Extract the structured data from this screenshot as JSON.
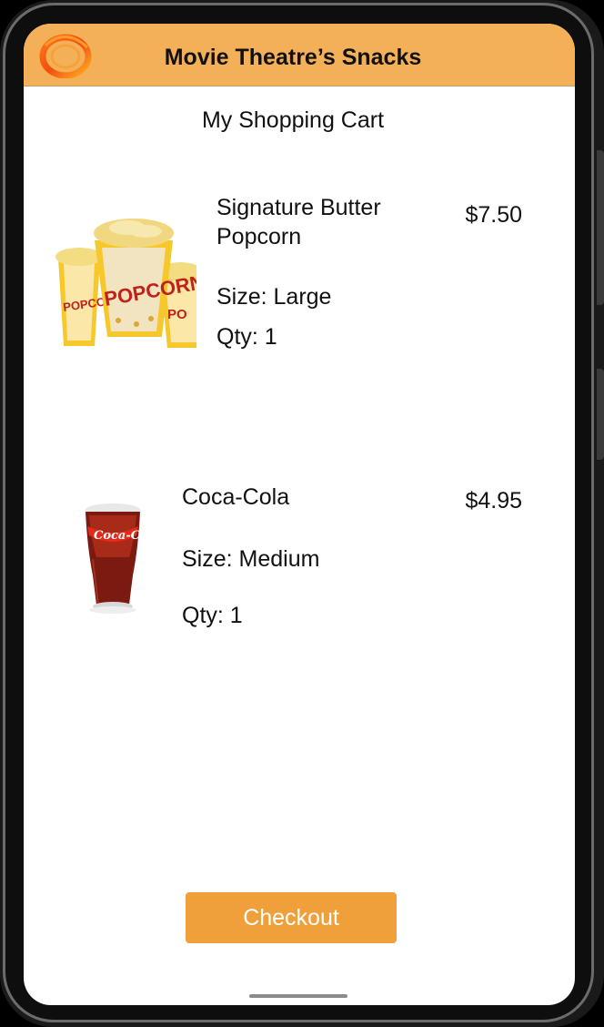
{
  "header": {
    "title": "Movie Theatre’s Snacks",
    "logo_icon": "ring-logo-icon"
  },
  "page_title": "My Shopping Cart",
  "cart": {
    "items": [
      {
        "name": "Signature Butter Popcorn",
        "price": "$7.50",
        "size": "Size: Large",
        "qty": "Qty: 1",
        "thumbnail_icon": "popcorn-image"
      },
      {
        "name": "Coca-Cola",
        "price": "$4.95",
        "size": "Size: Medium",
        "qty": "Qty: 1",
        "thumbnail_icon": "coca-cola-cup-image"
      }
    ]
  },
  "checkout": {
    "label": "Checkout"
  },
  "colors": {
    "header_bg": "#f4b058",
    "accent": "#f0a03a",
    "text": "#111111"
  }
}
